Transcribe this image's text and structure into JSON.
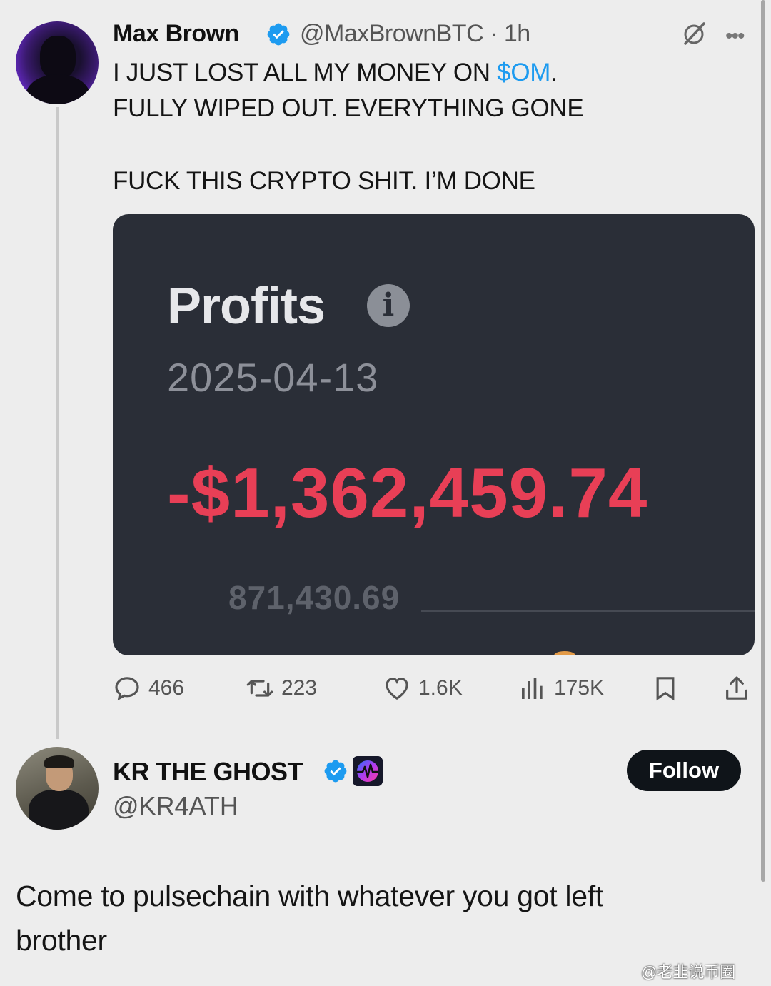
{
  "tweet": {
    "author_name": "Max Brown",
    "author_handle": "@MaxBrownBTC · 1h",
    "text_line_1_before": "I JUST LOST ALL MY MONEY ON ",
    "cashtag": "$OM",
    "text_line_1_after": ".",
    "text_line_2": "FULLY WIPED OUT. EVERYTHING GONE",
    "text_line_3": "FUCK THIS CRYPTO SHIT. I’M DONE",
    "icons": {
      "verified": "verified-badge-icon",
      "grok": "grok-icon",
      "more": "more-icon"
    }
  },
  "media": {
    "title": "Profits",
    "info_icon_glyph": "i",
    "date": "2025-04-13",
    "amount": "-$1,362,459.74",
    "sub_value": "871,430.69",
    "amount_color": "#e83f56"
  },
  "actions": {
    "replies": "466",
    "reposts": "223",
    "likes": "1.6K",
    "views": "175K",
    "icons": [
      "reply-icon",
      "repost-icon",
      "like-icon",
      "views-icon",
      "bookmark-icon",
      "share-icon"
    ]
  },
  "reply": {
    "author_name": "KR THE GHOST",
    "author_handle": "@KR4ATH",
    "follow_label": "Follow",
    "text_line_1": "Come to pulsechain with whatever you got left",
    "text_line_2": "brother"
  },
  "watermark": "@老韭说币圈",
  "colors": {
    "accent": "#1d9bf0",
    "background": "#ededed",
    "card": "#2a2e37",
    "negative": "#e83f56"
  }
}
